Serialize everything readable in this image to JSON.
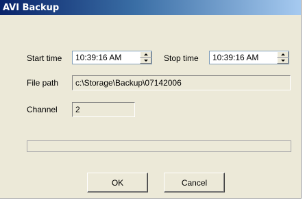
{
  "window": {
    "title": "AVI Backup"
  },
  "form": {
    "start_time_label": "Start time",
    "start_time_value": "10:39:16 AM",
    "stop_time_label": "Stop time",
    "stop_time_value": "10:39:16 AM",
    "file_path_label": "File path",
    "file_path_value": "c:\\Storage\\Backup\\07142006",
    "channel_label": "Channel",
    "channel_value": "2"
  },
  "progress": {
    "fraction": 0
  },
  "buttons": {
    "ok_label": "OK",
    "cancel_label": "Cancel"
  }
}
